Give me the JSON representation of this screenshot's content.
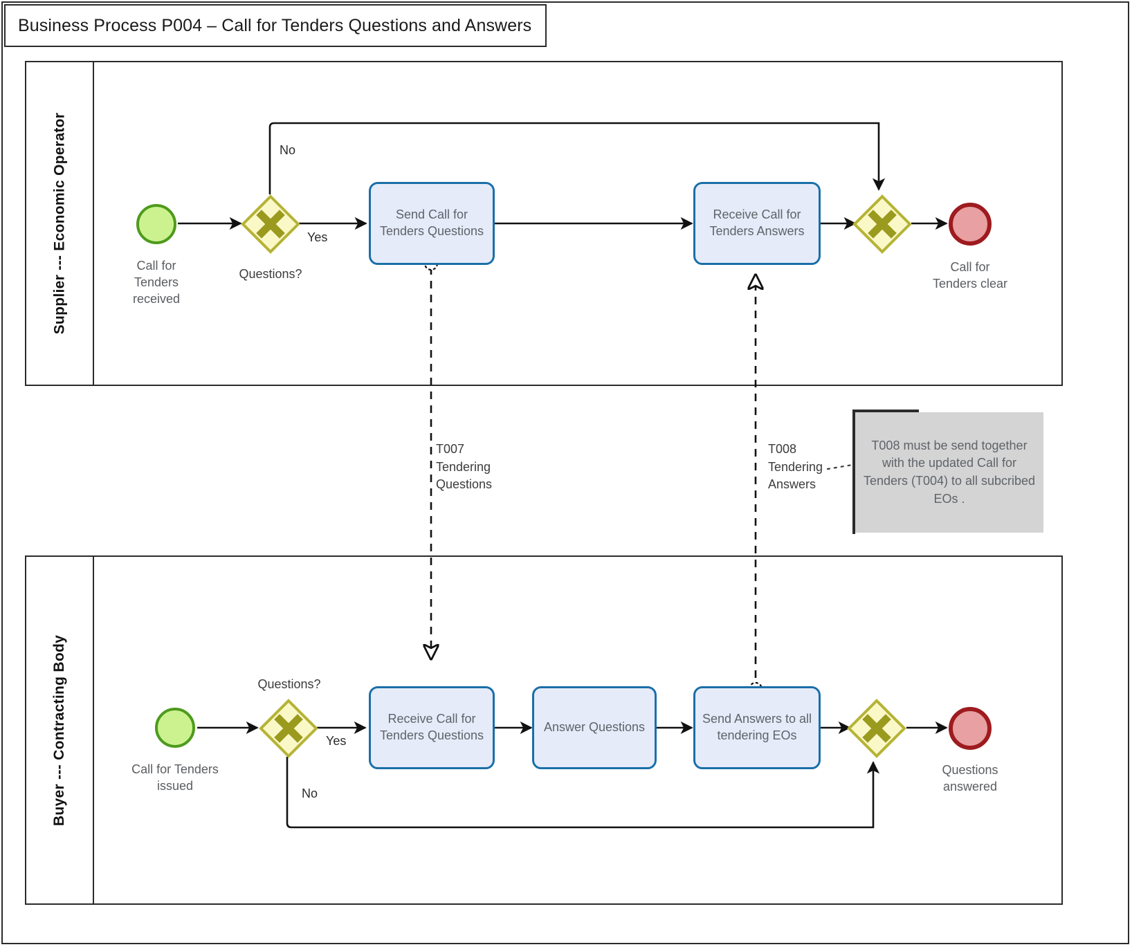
{
  "title": "Business Process P004 – Call for Tenders Questions and Answers",
  "pools": [
    {
      "id": "supplier",
      "label": "Supplier --- Economic Operator"
    },
    {
      "id": "buyer",
      "label": "Buyer --- Contracting Body"
    }
  ],
  "supplier_lane": {
    "start_event_label": "Call for\nTenders\nreceived",
    "gateway_label": "Questions?",
    "gateway_yes": "Yes",
    "gateway_no": "No",
    "task_send_questions": "Send Call for\nTenders\nQuestions",
    "task_receive_answers": "Receive Call for\nTenders Answers",
    "end_event_label": "Call for\nTenders clear"
  },
  "buyer_lane": {
    "start_event_label": "Call for Tenders\nissued",
    "gateway_label": "Questions?",
    "gateway_yes": "Yes",
    "gateway_no": "No",
    "task_receive_questions": "Receive Call for\nTenders\nQuestions",
    "task_answer_questions": "Answer\nQuestions",
    "task_send_answers": "Send Answers to\nall tendering\nEOs",
    "end_event_label": "Questions\nanswered"
  },
  "message_flows": [
    {
      "id": "t007",
      "label": "T007\nTendering\nQuestions"
    },
    {
      "id": "t008",
      "label": "T008\nTendering\nAnswers"
    }
  ],
  "annotation": {
    "text": "T008 must be send together with the updated Call for Tenders (T004) to all subcribed EOs ."
  },
  "colors": {
    "start_fill": "#ccf28f",
    "start_stroke": "#4d9b1d",
    "end_fill": "#e8a0a2",
    "end_stroke": "#9e1b1f",
    "task_fill": "#e6ebfa",
    "task_stroke": "#1a6fa8",
    "gateway_fill": "#fbf8c8",
    "gateway_stroke": "#b5b336",
    "gateway_mark": "#9a9a1e",
    "annotation_fill": "#d4d4d4",
    "line": "#1a1a1a"
  }
}
